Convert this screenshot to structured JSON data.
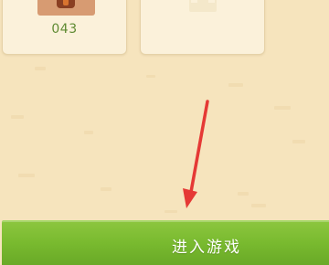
{
  "levels": [
    {
      "number": "043",
      "state": "unlocked",
      "thumb_icon": "level-thumbnail-icon"
    },
    {
      "number": "",
      "state": "locked",
      "thumb_icon": "locked-level-icon"
    }
  ],
  "enter_button": {
    "label": "进入游戏"
  },
  "annotation": {
    "icon": "red-arrow-icon",
    "color": "#e53935"
  },
  "theme": {
    "background": "#f6e4bd",
    "card": "#fbf1da",
    "accent_green": "#79ba2f",
    "level_number_color": "#5f8a32"
  }
}
